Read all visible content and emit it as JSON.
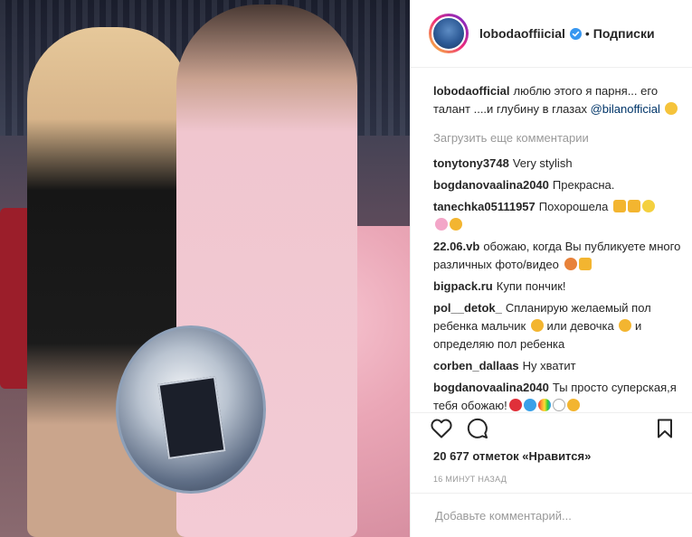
{
  "post": {
    "account": "lobodaoffiicial",
    "follow_state": "Подписки",
    "separator": "•"
  },
  "caption": {
    "user": "lobodaofficial",
    "text": "люблю этого я парня... его талант ....и глубину в глазах",
    "mention": "@bilanofficial"
  },
  "load_more": "Загрузить еще комментарии",
  "comments": [
    {
      "user": "tonytony3748",
      "text": "Very stylish"
    },
    {
      "user": "bogdanovaalina2040",
      "text": "Прекрасна."
    },
    {
      "user": "tanechka05111957",
      "text": "Похорошела"
    },
    {
      "user": "22.06.vb",
      "text": "обожаю, когда Вы публикуете много различных фото/видео"
    },
    {
      "user": "bigpack.ru",
      "text": "Купи пончик!"
    },
    {
      "user": "pol__detok_",
      "text": "Спланирую желаемый пол ребенка мальчик",
      "text2": "или девочка",
      "text3": "и определяю пол ребенка"
    },
    {
      "user": "corben_dallaas",
      "text": "Ну хватит"
    },
    {
      "user": "bogdanovaalina2040",
      "text": "Ты просто суперская,я тебя обожаю!"
    }
  ],
  "likes": "20 677 отметок «Нравится»",
  "timestamp": "16 минут назад",
  "add_comment_placeholder": "Добавьте комментарий...",
  "colors": {
    "mention": "#003569",
    "muted": "#999999",
    "verified": "#3897f0"
  },
  "icons": [
    "heart-icon",
    "comment-icon",
    "bookmark-icon",
    "verified-icon"
  ]
}
